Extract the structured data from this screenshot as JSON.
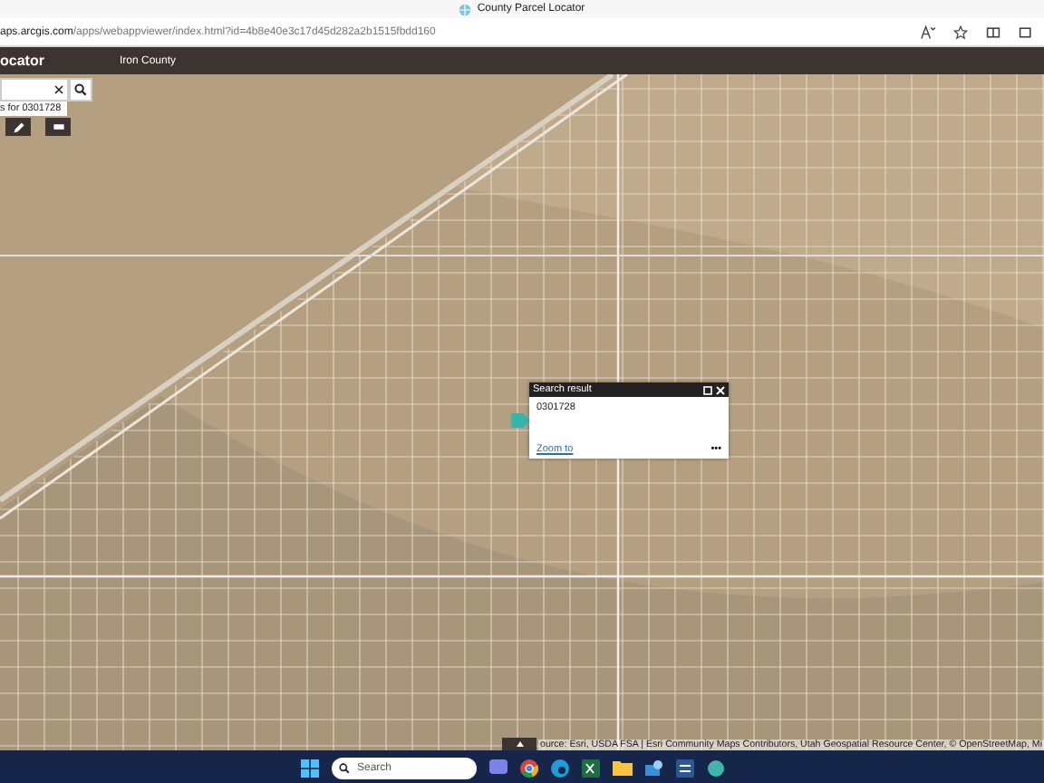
{
  "browser": {
    "tab_title": "County Parcel Locator",
    "url_host": "aps.arcgis.com",
    "url_path": "/apps/webappviewer/index.html?id=4b8e40e3c17d45d282a2b1515fbdd160"
  },
  "app_header": {
    "title": "ocator",
    "subtitle": "Iron County"
  },
  "search": {
    "suggestion": "s for 0301728"
  },
  "popup": {
    "title": "Search result",
    "value": "0301728",
    "link": "Zoom to",
    "more": "•••"
  },
  "attribution": "ource: Esri, USDA FSA | Esri Community Maps Contributors, Utah Geospatial Resource Center, © OpenStreetMap, Mi",
  "taskbar": {
    "search_placeholder": "Search"
  }
}
